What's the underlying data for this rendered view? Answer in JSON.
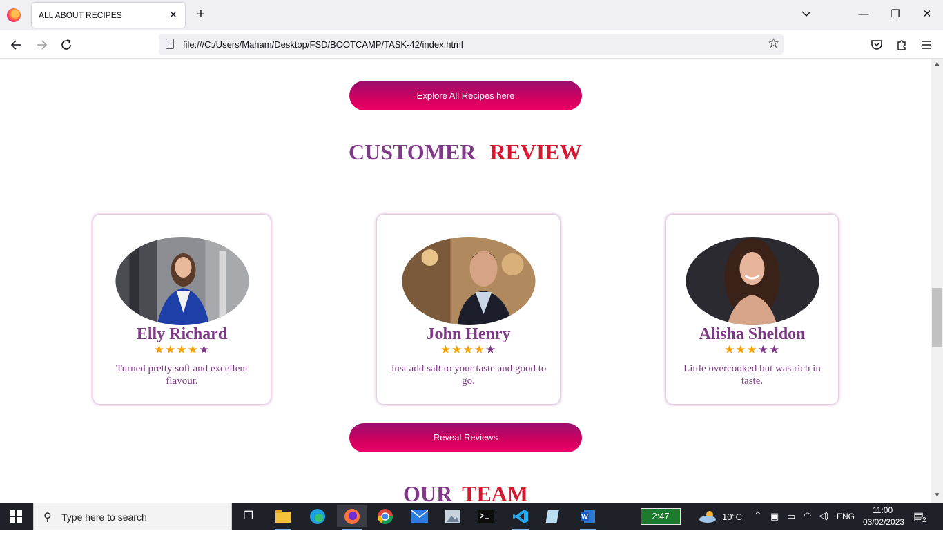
{
  "browser": {
    "tab_title": "ALL ABOUT RECIPES",
    "close_tab_glyph": "✕",
    "new_tab_glyph": "+",
    "url": "file:///C:/Users/Maham/Desktop/FSD/BOOTCAMP/TASK-42/index.html",
    "window_minimize": "—",
    "window_restore": "❐",
    "window_close": "✕"
  },
  "page": {
    "explore_button": "Explore All Recipes here",
    "review_heading_a": "CUSTOMER",
    "review_heading_b": "REVIEW",
    "reviews": [
      {
        "name": "Elly Richard",
        "rating": 4,
        "text": "Turned pretty soft and excellent flavour."
      },
      {
        "name": "John Henry",
        "rating": 4,
        "text": "Just add salt to your taste and good to go."
      },
      {
        "name": "Alisha Sheldon",
        "rating": 3,
        "text": "Little overcooked but was rich in taste."
      }
    ],
    "reveal_button": "Reveal Reviews",
    "team_heading_a": "OUR",
    "team_heading_b": "TEAM"
  },
  "colors": {
    "accent_purple": "#7e3a87",
    "accent_red": "#d6172f",
    "star_gold": "#f4a100",
    "button_pink": "#d1005f"
  },
  "taskbar": {
    "search_placeholder": "Type here to search",
    "battery_timer": "2:47",
    "temperature": "10°C",
    "language": "ENG",
    "time": "11:00",
    "date": "03/02/2023",
    "notification_count": "2"
  }
}
